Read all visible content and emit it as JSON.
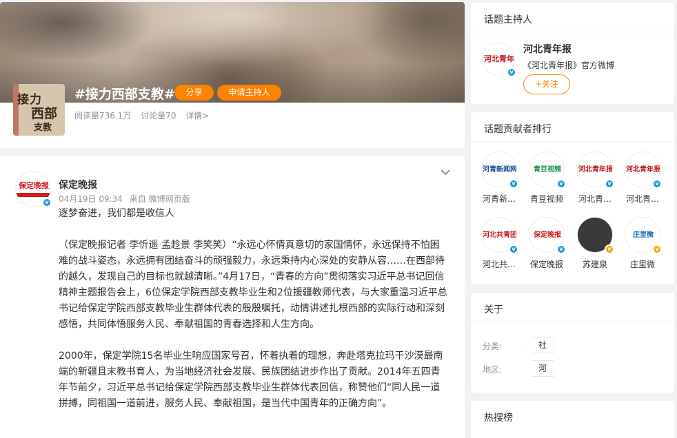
{
  "topic": {
    "title": "#接力西部支教#",
    "share_label": "分享",
    "apply_host_label": "申请主持人",
    "reads": "阅读量736.1万",
    "discussions": "讨论量70",
    "details": "详情>",
    "logo_lines": [
      "接力",
      "西部",
      "支教"
    ]
  },
  "post": {
    "author": "保定晚报",
    "avatar_text": "保定晚报",
    "date": "04月19日 09:34",
    "source": "来自 微博网页版",
    "paragraphs": [
      "逐梦奋进，我们都是收信人",
      "（保定晚报记者 李忻遥 孟趁景 李笑笑）“永远心怀情真意切的家国情怀，永远保持不怕困难的战斗姿态，永远拥有团结奋斗的顽强毅力，永远秉持内心深处的安静从容……在西部待的越久，发现自己的目标也就越清晰。”4月17日，“青春的方向”贯彻落实习近平总书记回信精神主题报告会上，6位保定学院西部支教毕业生和2位援疆教师代表，与大家重温习近平总书记给保定学院西部支教毕业生群体代表的殷殷嘱托，动情讲述扎根西部的实际行动和深刻感悟，共同体悟服务人民、奉献祖国的青春选择和人生方向。",
      "2000年，保定学院15名毕业生响应国家号召，怀着执着的理想，奔赴塔克拉玛干沙漠最南端的新疆且末教书育人，为当地经济社会发展、民族团结进步作出了贡献。2014年五四青年节前夕，习近平总书记给保定学院西部支教毕业生群体代表回信，称赞他们“同人民一道拼搏，同祖国一道前进，服务人民、奉献祖国，是当代中国青年的正确方向”。"
    ]
  },
  "host_panel": {
    "title": "话题主持人",
    "name": "河北青年报",
    "avatar_text": "河北青年报",
    "description": "《河北青年报》官方微博",
    "follow_label": "+关注"
  },
  "rank_panel": {
    "title": "话题贡献者排行",
    "items": [
      {
        "name": "河青新…",
        "avatar_text": "河青新闻网",
        "color": "#1f4e9c",
        "badge": "blue"
      },
      {
        "name": "青豆视频",
        "avatar_text": "青豆视频",
        "color": "#1a8f4e",
        "badge": "blue"
      },
      {
        "name": "河北青…",
        "avatar_text": "河北青年报",
        "color": "#c4161c",
        "badge": "blue"
      },
      {
        "name": "河北青…",
        "avatar_text": "河北青年报",
        "color": "#c4161c",
        "badge": "blue"
      },
      {
        "name": "河北共…",
        "avatar_text": "河北共青团",
        "color": "#c4161c",
        "badge": "blue"
      },
      {
        "name": "保定晚报",
        "avatar_text": "保定晚报",
        "color": "#d21b1b",
        "badge": "blue"
      },
      {
        "name": "苏建泉",
        "avatar_text": "",
        "color": "#333333",
        "badge": "gold"
      },
      {
        "name": "庄里微",
        "avatar_text": "庄里微",
        "color": "#1c6fb5",
        "badge": "gold"
      }
    ]
  },
  "about_panel": {
    "title": "关于",
    "category_label": "分类:",
    "category_value": "社会",
    "region_label": "地区:",
    "region_value": "河北"
  },
  "hot_panel": {
    "title": "热搜榜"
  },
  "colors": {
    "accent": "#ff8200",
    "verified": "#1a9bd7",
    "gold_verified": "#f5a900"
  }
}
